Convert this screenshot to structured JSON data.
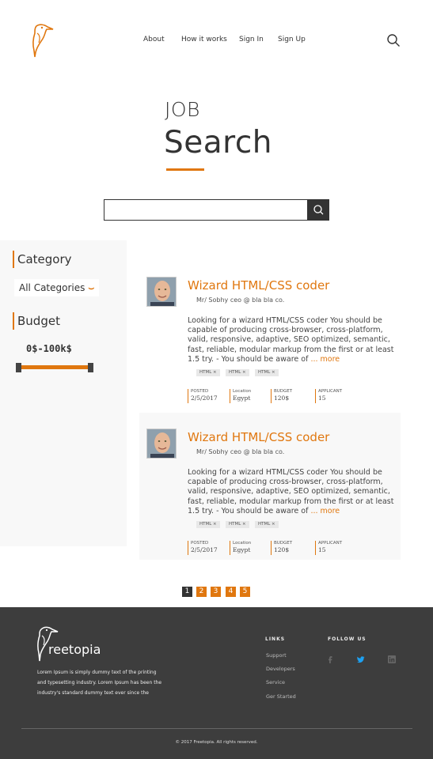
{
  "nav": {
    "items": [
      "About",
      "How it works",
      "Sign In",
      "Sign Up"
    ]
  },
  "hero": {
    "line1": "JOB",
    "line2": "Search",
    "search_placeholder": ""
  },
  "sidebar": {
    "category_title": "Category",
    "category_selected": "All Categories",
    "budget_title": "Budget",
    "budget_range": "0$-100k$",
    "budget_min_fraction": 0,
    "budget_max_fraction": 1
  },
  "jobs": [
    {
      "title": "Wizard HTML/CSS coder",
      "poster": "Mr/ Sobhy ceo @ bla bla co.",
      "description": "Looking for a wizard HTML/CSS coder You should be capable of producing cross-browser, cross-platform, valid, responsive, adaptive, SEO optimized, semantic, fast, reliable, modular markup from the first or at least 1.5 try. - You should be aware of ",
      "more": "... more",
      "tags": [
        "HTML ×",
        "HTML ×",
        "HTML ×"
      ],
      "meta": [
        {
          "label": "POSTED",
          "value": "2/5/2017"
        },
        {
          "label": "Location",
          "value": "Egypt"
        },
        {
          "label": "BUDGET",
          "value": "120$"
        },
        {
          "label": "APPLICANT",
          "value": "15"
        }
      ]
    },
    {
      "title": "Wizard HTML/CSS coder",
      "poster": "Mr/ Sobhy ceo @ bla bla co.",
      "description": "Looking for a wizard HTML/CSS coder You should be capable of producing cross-browser, cross-platform, valid, responsive, adaptive, SEO optimized, semantic, fast, reliable, modular markup from the first or at least 1.5 try. - You should be aware of ",
      "more": "... more",
      "tags": [
        "HTML ×",
        "HTML ×",
        "HTML ×"
      ],
      "meta": [
        {
          "label": "POSTED",
          "value": "2/5/2017"
        },
        {
          "label": "Location",
          "value": "Egypt"
        },
        {
          "label": "BUDGET",
          "value": "120$"
        },
        {
          "label": "APPLICANT",
          "value": "15"
        }
      ]
    }
  ],
  "pagination": {
    "pages": [
      "1",
      "2",
      "3",
      "4",
      "5"
    ],
    "current": "1"
  },
  "footer": {
    "brand": "reetopia",
    "about": "Lorem Ipsum is simply dummy text of the printing and typesetting industry. Lorem Ipsum has been the industry's standard dummy text ever since the",
    "links_title": "LINKS",
    "links": [
      "Support",
      "Developers",
      "Service",
      "Ger Started"
    ],
    "follow_title": "FOLLOW US",
    "social": [
      "facebook-icon",
      "twitter-icon",
      "linkedin-icon"
    ],
    "copyright": "© 2017 Freetopia. All rights reserved."
  },
  "colors": {
    "accent": "#e0770f",
    "footer_bg": "#3d3d3d",
    "dark": "#333333",
    "twitter": "#1da1f2"
  }
}
